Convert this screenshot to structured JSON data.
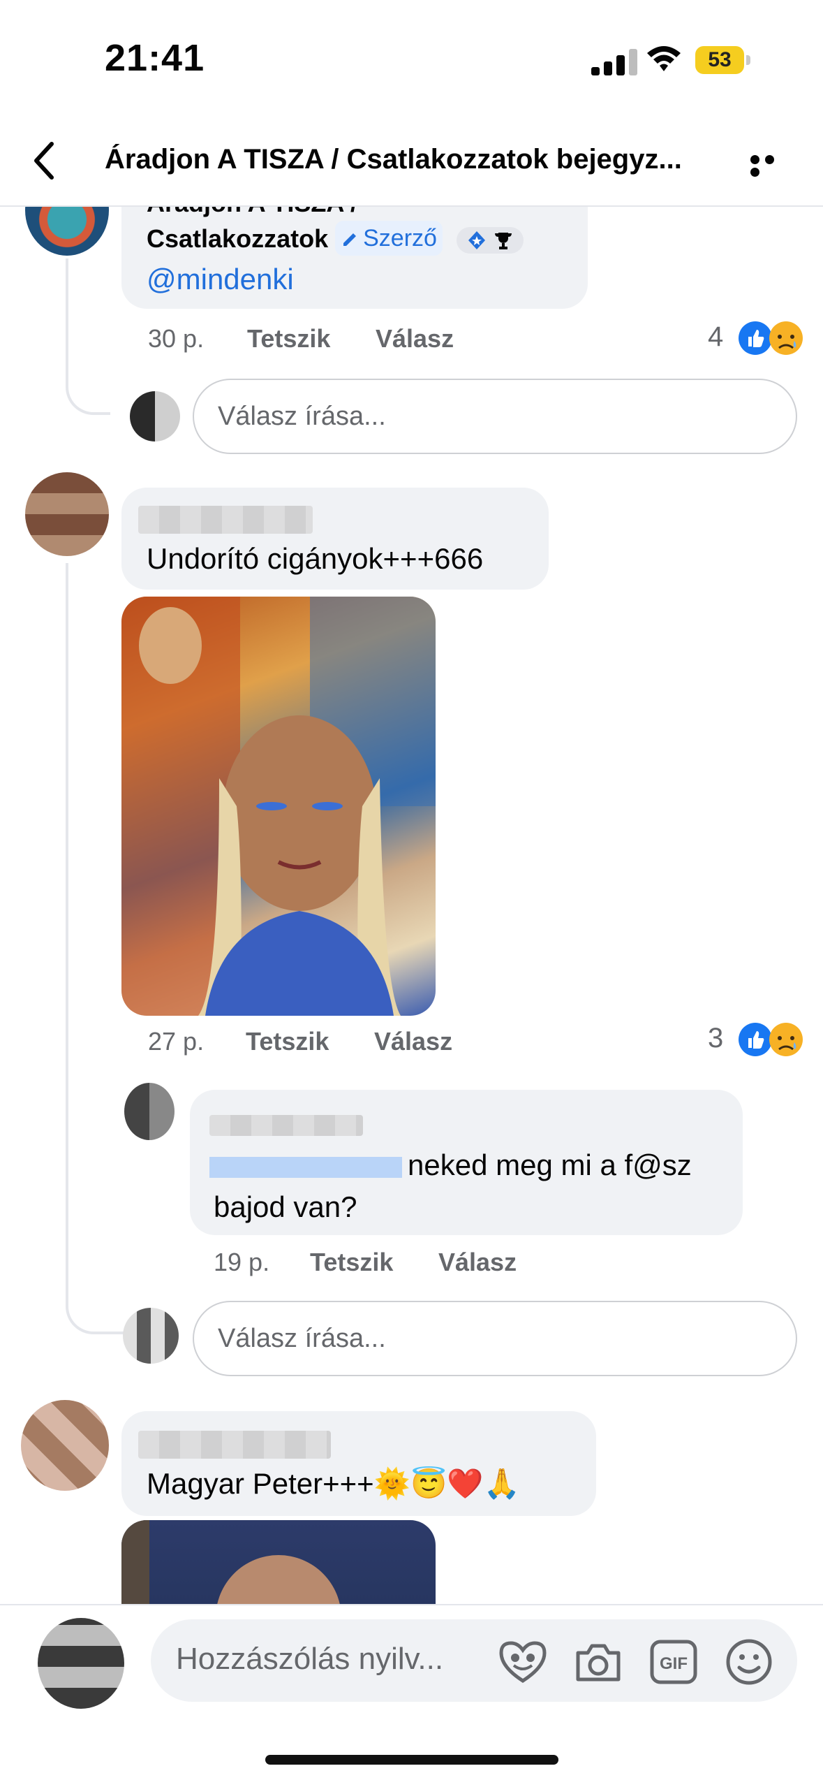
{
  "status": {
    "time": "21:41",
    "battery": "53"
  },
  "header": {
    "title": "Áradjon A TISZA / Csatlakozzatok  bejegyz..."
  },
  "comments": [
    {
      "name_line1": "Áradjon A TISZA /",
      "name_line2": "Csatlakozzatok",
      "badge": "Szerző",
      "mention": "@mindenki",
      "time": "30 p.",
      "like": "Tetszik",
      "reply": "Válasz",
      "reactions": "4"
    },
    {
      "text": "Undorító cigányok+++666",
      "time": "27 p.",
      "like": "Tetszik",
      "reply": "Válasz",
      "reactions": "3"
    },
    {
      "text_after_mention": "neked meg mi a f@sz",
      "text_line2": "bajod van?",
      "time": "19 p.",
      "like": "Tetszik",
      "reply": "Válasz"
    },
    {
      "text": "Magyar Peter+++🌞😇❤️🙏"
    }
  ],
  "reply_placeholder": "Válasz írása...",
  "composer": {
    "placeholder": "Hozzászólás nyilv..."
  },
  "icons": [
    "back-icon",
    "more-icon",
    "like-icon",
    "sad-icon",
    "avatar-frame-icon",
    "camera-icon",
    "gif-icon",
    "emoji-icon"
  ],
  "colors": {
    "accent": "#216fdb",
    "bubble": "#f0f2f5",
    "battery": "#f5cd1f"
  }
}
